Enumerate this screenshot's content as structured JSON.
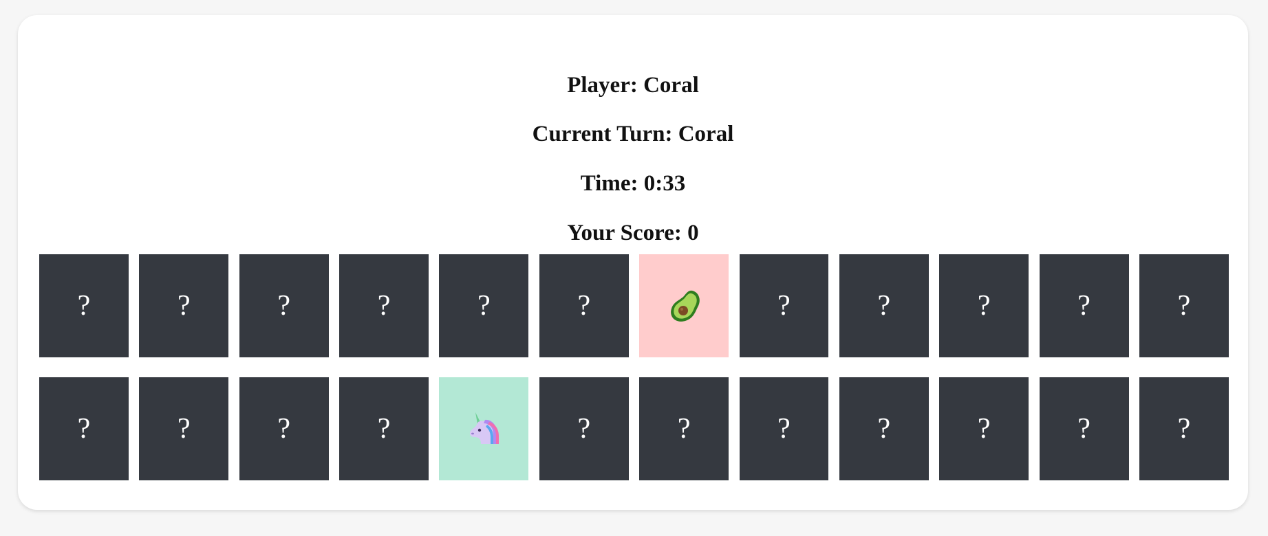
{
  "header": {
    "player": "Player: Coral",
    "turn": "Current Turn: Coral",
    "time": "Time: 0:33",
    "score": "Your Score: 0"
  },
  "hidden_symbol": "?",
  "colors": {
    "card_back": "#353940",
    "avocado_bg": "#ffcccc",
    "unicorn_bg": "#b3e8d5"
  },
  "board": {
    "rows": [
      [
        "hidden",
        "hidden",
        "hidden",
        "hidden",
        "hidden",
        "hidden",
        "avocado",
        "hidden",
        "hidden",
        "hidden",
        "hidden",
        "hidden"
      ],
      [
        "hidden",
        "hidden",
        "hidden",
        "hidden",
        "unicorn",
        "hidden",
        "hidden",
        "hidden",
        "hidden",
        "hidden",
        "hidden",
        "hidden"
      ]
    ]
  }
}
